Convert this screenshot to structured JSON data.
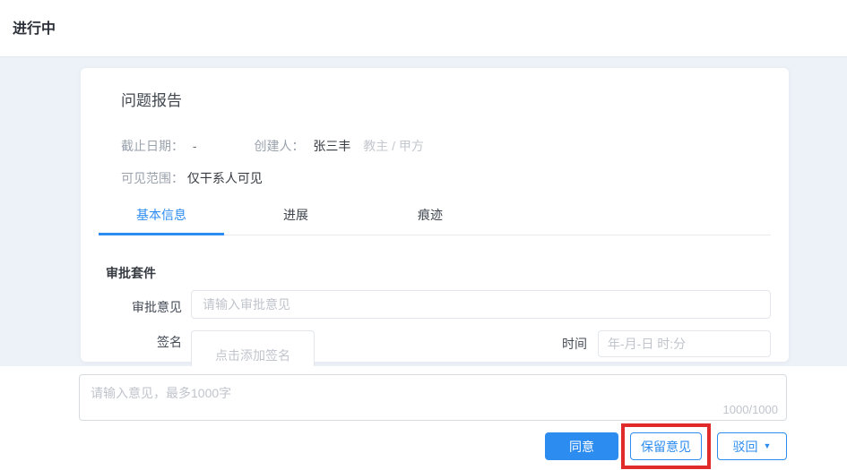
{
  "page": {
    "status_title": "进行中"
  },
  "card": {
    "title": "问题报告",
    "meta": {
      "deadline_label": "截止日期：",
      "deadline_value": "-",
      "creator_label": "创建人：",
      "creator_name": "张三丰",
      "creator_role": "教主 / 甲方",
      "visibility_label": "可见范围：",
      "visibility_value": "仅干系人可见"
    },
    "tabs": [
      {
        "label": "基本信息",
        "active": true
      },
      {
        "label": "进展",
        "active": false
      },
      {
        "label": "痕迹",
        "active": false
      }
    ],
    "form": {
      "section_title": "审批套件",
      "opinion_label": "审批意见",
      "opinion_placeholder": "请输入审批意见",
      "signature_label": "签名",
      "signature_placeholder": "点击添加签名",
      "time_label": "时间",
      "time_placeholder": "年-月-日 时:分"
    }
  },
  "footer": {
    "comment_placeholder": "请输入意见，最多1000字",
    "counter": "1000/1000",
    "agree_label": "同意",
    "reserve_label": "保留意见",
    "reject_label": "驳回",
    "reject_caret": "▼"
  },
  "colors": {
    "accent_blue": "#2d8cf0",
    "highlight_red": "#e12a2a",
    "page_background": "#edf1f8",
    "placeholder_gray": "#c0c4cc"
  }
}
